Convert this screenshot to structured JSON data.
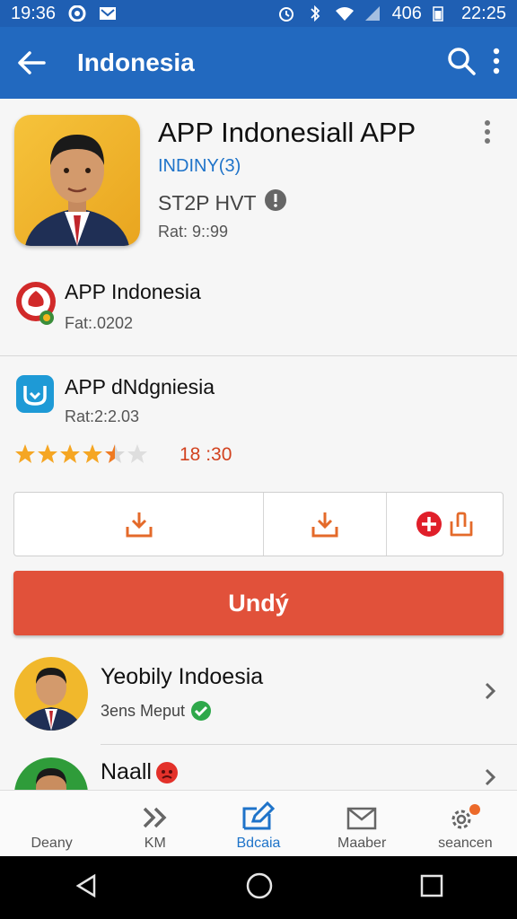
{
  "status_bar": {
    "time": "19:36",
    "battery_percent": "406",
    "clock_right": "22:25"
  },
  "app_bar": {
    "title": "Indonesia"
  },
  "hero": {
    "title": "APP Indonesiall APP",
    "subtitle": "INDINY(3)",
    "meta": "ST2P HVT",
    "rating": "Rat: 9::99"
  },
  "rows": [
    {
      "title": "APP Indonesia",
      "sub": "Fat:.0202"
    },
    {
      "title": "APP dNdgniesia",
      "sub": "Rat:2:2.03"
    }
  ],
  "rating_row": {
    "stars": 4.5,
    "time": "18 :30"
  },
  "primary_button": {
    "label": "Undý"
  },
  "list": [
    {
      "name": "Yeobily Indoesia",
      "detail": "3ens Meput"
    },
    {
      "name": "Naall"
    }
  ],
  "bottom_nav": [
    {
      "label": "Deany"
    },
    {
      "label": "KM"
    },
    {
      "label": "Bdcaia"
    },
    {
      "label": "Maaber"
    },
    {
      "label": "seancen"
    }
  ],
  "colors": {
    "app_bar": "#2269bf",
    "accent_red": "#e1513a",
    "link_blue": "#1e73c9",
    "star": "#f5a623"
  }
}
